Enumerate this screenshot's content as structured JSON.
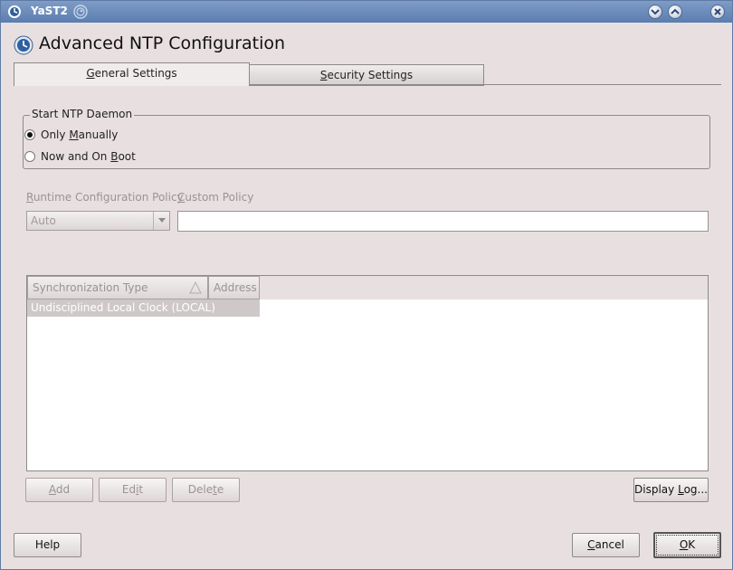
{
  "window": {
    "title": "YaST2",
    "colors": {
      "titlebar": "#6a8bbd",
      "background": "#e8e0e0"
    }
  },
  "header": {
    "title": "Advanced NTP Configuration"
  },
  "tabs": [
    {
      "label_pre": "",
      "label_key": "G",
      "label_post": "eneral Settings",
      "active": true
    },
    {
      "label_pre": "",
      "label_key": "S",
      "label_post": "ecurity Settings",
      "active": false
    }
  ],
  "daemon_group": {
    "legend": "Start NTP Daemon",
    "options": [
      {
        "pre": "Only ",
        "key": "M",
        "post": "anually",
        "checked": true
      },
      {
        "pre": "Now and On ",
        "key": "B",
        "post": "oot",
        "checked": false
      }
    ]
  },
  "policy": {
    "runtime_label_key": "R",
    "runtime_label_post": "untime Configuration Policy",
    "runtime_value": "Auto",
    "custom_label_key": "C",
    "custom_label_post": "ustom Policy",
    "custom_value": ""
  },
  "table": {
    "columns": [
      "Synchronization Type",
      "Address"
    ],
    "rows": [
      {
        "type": "Undisciplined Local Clock (LOCAL)",
        "address": ""
      }
    ]
  },
  "buttons": {
    "add": {
      "key": "A",
      "post": "dd"
    },
    "edit": {
      "pre": "Ed",
      "key": "i",
      "post": "t"
    },
    "delete": {
      "pre": "Dele",
      "key": "t",
      "post": "e"
    },
    "display_log": {
      "pre": "Display ",
      "key": "L",
      "post": "og..."
    },
    "help": "Help",
    "cancel": {
      "key": "C",
      "post": "ancel"
    },
    "ok": {
      "key": "O",
      "post": "K"
    }
  }
}
